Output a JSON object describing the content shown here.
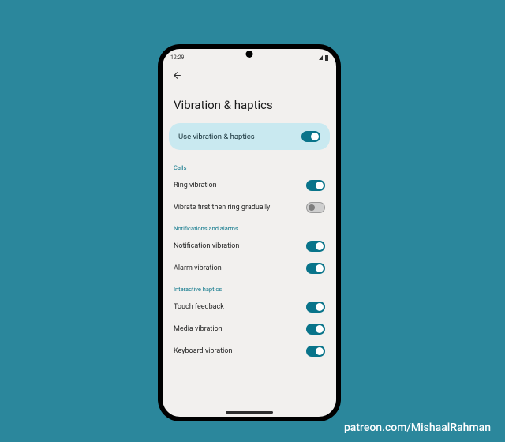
{
  "statusbar": {
    "time": "12:29",
    "icons_left": "🖬 ⬛",
    "icons_right": "◢ ▮"
  },
  "page": {
    "title": "Vibration & haptics"
  },
  "master": {
    "label": "Use vibration & haptics",
    "on": true
  },
  "sections": [
    {
      "header": "Calls",
      "items": [
        {
          "label": "Ring vibration",
          "on": true
        },
        {
          "label": "Vibrate first then ring gradually",
          "on": false
        }
      ]
    },
    {
      "header": "Notifications and alarms",
      "items": [
        {
          "label": "Notification vibration",
          "on": true
        },
        {
          "label": "Alarm vibration",
          "on": true
        }
      ]
    },
    {
      "header": "Interactive haptics",
      "items": [
        {
          "label": "Touch feedback",
          "on": true
        },
        {
          "label": "Media vibration",
          "on": true
        },
        {
          "label": "Keyboard vibration",
          "on": true
        }
      ]
    }
  ],
  "credit": "patreon.com/MishaalRahman"
}
